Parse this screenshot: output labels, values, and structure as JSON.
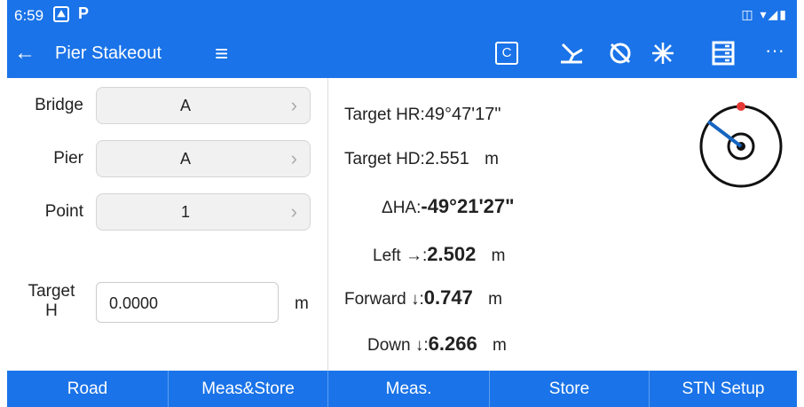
{
  "status": {
    "time": "6:59",
    "p_icon": "P"
  },
  "appbar": {
    "title": "Pier Stakeout",
    "c_label": "C",
    "more": "···"
  },
  "form": {
    "bridge": {
      "label": "Bridge",
      "value": "A"
    },
    "pier": {
      "label": "Pier",
      "value": "A"
    },
    "point": {
      "label": "Point",
      "value": "1"
    },
    "target_h": {
      "label_line1": "Target",
      "label_line2": "H",
      "value": "0.0000",
      "unit": "m"
    }
  },
  "results": {
    "target_hr_label": "Target HR:",
    "target_hr_value": "49°47'17\"",
    "target_hd_label": "Target HD:",
    "target_hd_value": "2.551",
    "target_hd_unit": "m",
    "dha_label": "ΔHA:",
    "dha_value": "-49°21'27\"",
    "left_label": "Left →:",
    "left_value": "2.502",
    "left_unit": "m",
    "forward_label": "Forward ↓:",
    "forward_value": "0.747",
    "forward_unit": "m",
    "down_label": "Down ↓:",
    "down_value": "6.266",
    "down_unit": "m"
  },
  "bottom": {
    "road": "Road",
    "meas_store": "Meas&Store",
    "meas": "Meas.",
    "store": "Store",
    "stn_setup": "STN Setup"
  },
  "colors": {
    "primary": "#1a73e8",
    "compass_dot": "#e53935",
    "compass_needle": "#1565c0"
  }
}
